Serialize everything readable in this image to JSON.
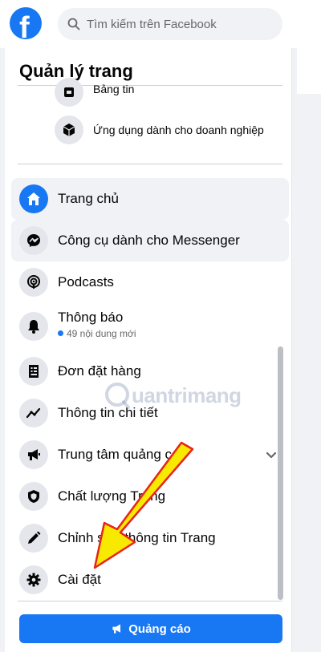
{
  "header": {
    "logo_letter": "f",
    "search_placeholder": "Tìm kiếm trên Facebook"
  },
  "panel": {
    "title": "Quản lý trang",
    "sub_items": [
      {
        "label": "Bảng tin",
        "icon": "news-feed-icon"
      },
      {
        "label": "Ứng dụng dành cho doanh nghiệp",
        "icon": "business-apps-icon"
      }
    ],
    "nav_items": [
      {
        "label": "Trang chủ",
        "icon": "home-icon",
        "active": true
      },
      {
        "label": "Công cụ dành cho Messenger",
        "icon": "messenger-icon",
        "active": true
      },
      {
        "label": "Podcasts",
        "icon": "podcast-icon"
      },
      {
        "label": "Thông báo",
        "icon": "bell-icon",
        "sub": "49 nội dung mới"
      },
      {
        "label": "Đơn đặt hàng",
        "icon": "orders-icon"
      },
      {
        "label": "Thông tin chi tiết",
        "icon": "insights-icon"
      },
      {
        "label": "Trung tâm quảng cáo",
        "icon": "megaphone-icon",
        "expandable": true
      },
      {
        "label": "Chất lượng Trang",
        "icon": "shield-icon"
      },
      {
        "label": "Chỉnh sửa thông tin Trang",
        "icon": "pencil-icon"
      },
      {
        "label": "Cài đặt",
        "icon": "gear-icon"
      }
    ],
    "ad_button_label": "Quảng cáo"
  },
  "watermark": {
    "text": "uantrimang"
  },
  "colors": {
    "brand": "#1877f2",
    "annotation_arrow": "#f7ea00",
    "annotation_outline": "#e8231b"
  }
}
